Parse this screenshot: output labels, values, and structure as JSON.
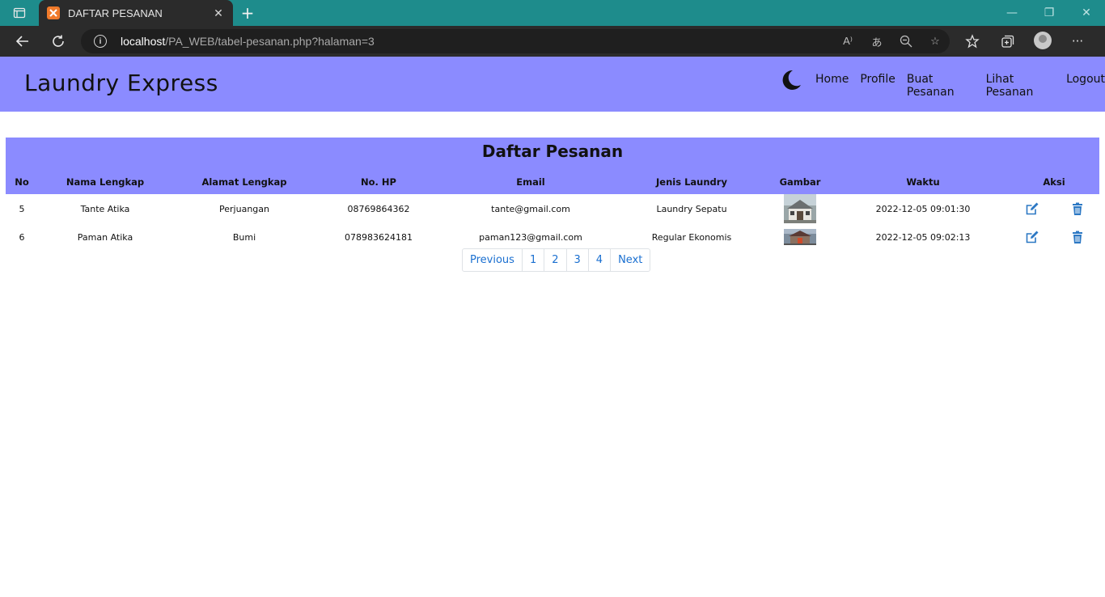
{
  "browser": {
    "tab_title": "DAFTAR PESANAN",
    "url_host": "localhost",
    "url_path": "/PA_WEB/tabel-pesanan.php?halaman=3"
  },
  "site": {
    "brand": "Laundry Express",
    "nav": [
      "Home",
      "Profile",
      "Buat Pesanan",
      "Lihat Pesanan",
      "Logout"
    ],
    "header_color": "#8b8bff"
  },
  "table": {
    "title": "Daftar Pesanan",
    "columns": [
      "No",
      "Nama Lengkap",
      "Alamat Lengkap",
      "No. HP",
      "Email",
      "Jenis Laundry",
      "Gambar",
      "Waktu",
      "Aksi"
    ],
    "rows": [
      {
        "no": "5",
        "nama": "Tante Atika",
        "alamat": "Perjuangan",
        "hp": "08769864362",
        "email": "tante@gmail.com",
        "jenis": "Laundry Sepatu",
        "waktu": "2022-12-05 09:01:30"
      },
      {
        "no": "6",
        "nama": "Paman Atika",
        "alamat": "Bumi",
        "hp": "078983624181",
        "email": "paman123@gmail.com",
        "jenis": "Regular Ekonomis",
        "waktu": "2022-12-05 09:02:13"
      }
    ]
  },
  "pagination": {
    "previous": "Previous",
    "pages": [
      "1",
      "2",
      "3",
      "4"
    ],
    "next": "Next"
  }
}
